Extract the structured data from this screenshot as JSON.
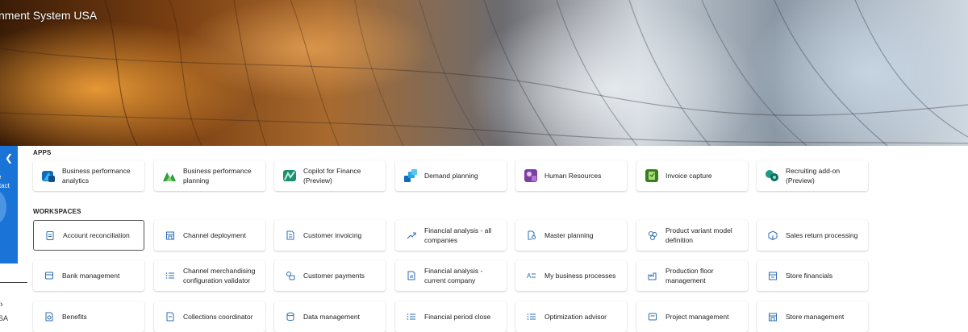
{
  "header": {
    "title": "nment System USA"
  },
  "side_panel": {
    "line1": "e",
    "line2": "ontact",
    "sa": "SA"
  },
  "apps": {
    "label": "APPS",
    "items": [
      {
        "label": "Business performance analytics",
        "icon": "business-performance-analytics-icon"
      },
      {
        "label": "Business performance planning",
        "icon": "business-performance-planning-icon"
      },
      {
        "label": "Copilot for Finance (Preview)",
        "icon": "copilot-finance-icon"
      },
      {
        "label": "Demand planning",
        "icon": "demand-planning-icon"
      },
      {
        "label": "Human Resources",
        "icon": "human-resources-icon"
      },
      {
        "label": "Invoice capture",
        "icon": "invoice-capture-icon"
      },
      {
        "label": "Recruiting add-on (Preview)",
        "icon": "recruiting-icon"
      }
    ]
  },
  "workspaces": {
    "label": "WORKSPACES",
    "rows": [
      [
        {
          "label": "Account reconciliation",
          "icon": "clipboard-icon"
        },
        {
          "label": "Channel deployment",
          "icon": "store-icon"
        },
        {
          "label": "Customer invoicing",
          "icon": "invoice-icon"
        },
        {
          "label": "Financial analysis - all companies",
          "icon": "trend-icon"
        },
        {
          "label": "Master planning",
          "icon": "document-search-icon"
        },
        {
          "label": "Product variant model definition",
          "icon": "cubes-icon"
        },
        {
          "label": "Sales return processing",
          "icon": "box-return-icon"
        }
      ],
      [
        {
          "label": "Bank management",
          "icon": "bank-icon"
        },
        {
          "label": "Channel merchandising configuration validator",
          "icon": "list-check-icon"
        },
        {
          "label": "Customer payments",
          "icon": "payment-icon"
        },
        {
          "label": "Financial analysis - current company",
          "icon": "document-chart-icon"
        },
        {
          "label": "My business processes",
          "icon": "process-list-icon"
        },
        {
          "label": "Production floor management",
          "icon": "factory-icon"
        },
        {
          "label": "Store financials",
          "icon": "store-finance-icon"
        }
      ],
      [
        {
          "label": "Benefits",
          "icon": "benefits-icon"
        },
        {
          "label": "Collections coordinator",
          "icon": "collections-icon"
        },
        {
          "label": "Data management",
          "icon": "database-icon"
        },
        {
          "label": "Financial period close",
          "icon": "checklist-icon"
        },
        {
          "label": "Optimization advisor",
          "icon": "advisor-list-icon"
        },
        {
          "label": "Project management",
          "icon": "project-icon"
        },
        {
          "label": "Store management",
          "icon": "store-manage-icon"
        }
      ]
    ]
  },
  "colors": {
    "accent": "#1a73d6",
    "icon_blue": "#2b6cb0"
  }
}
